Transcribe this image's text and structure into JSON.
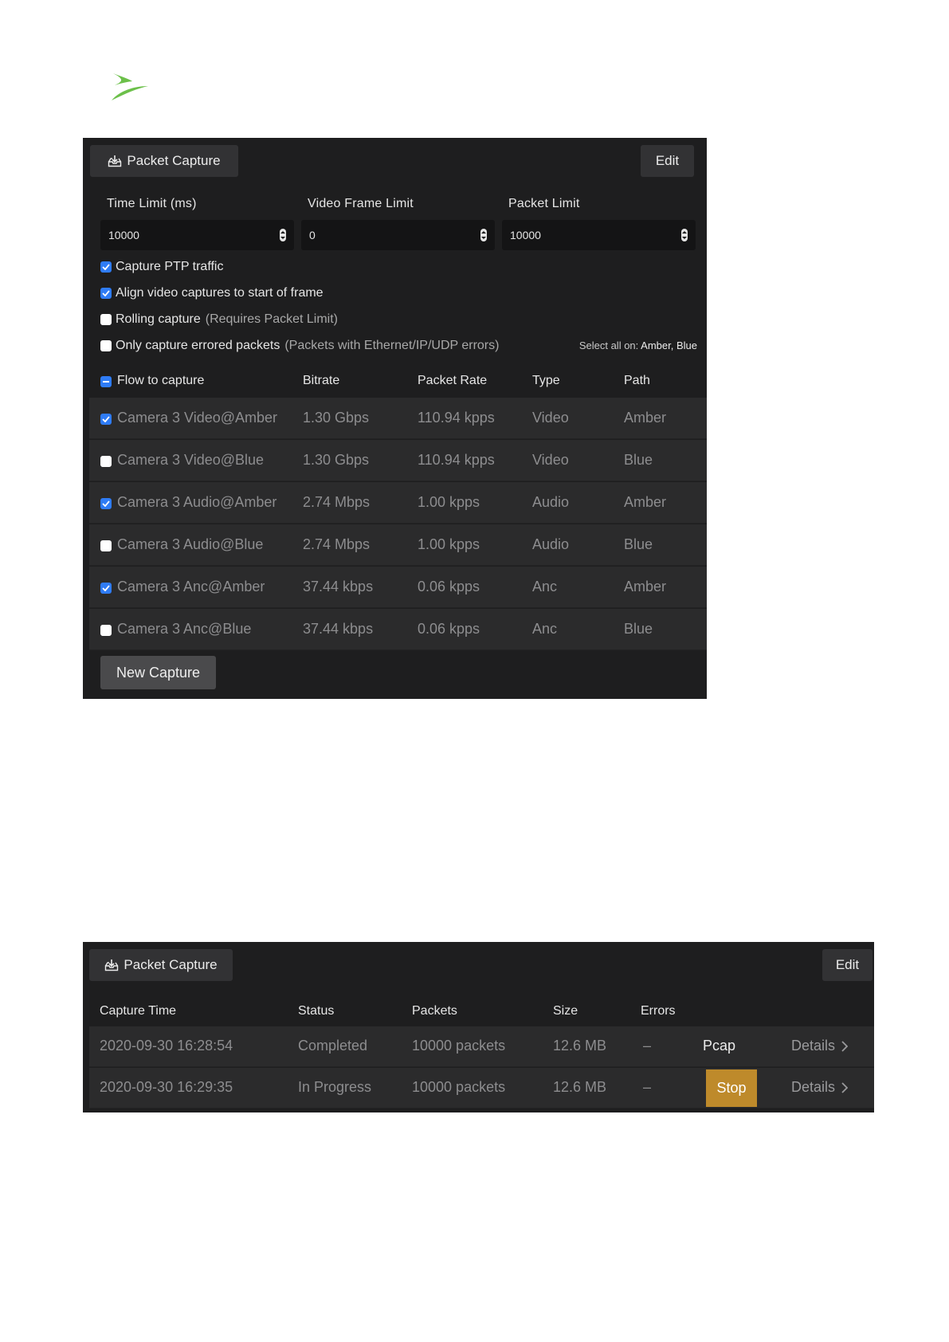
{
  "logo": {
    "icon": "brand-swoosh-logo",
    "color": "#6cc04a"
  },
  "config_panel": {
    "title": "Packet Capture",
    "title_icon": "inbox-download-icon",
    "edit_label": "Edit",
    "fields": [
      {
        "label": "Time Limit (ms)",
        "value": "10000"
      },
      {
        "label": "Video Frame Limit",
        "value": "0"
      },
      {
        "label": "Packet Limit",
        "value": "10000"
      }
    ],
    "options": [
      {
        "label": "Capture PTP traffic",
        "hint": "",
        "checked": true
      },
      {
        "label": "Align video captures to start of frame",
        "hint": "",
        "checked": true
      },
      {
        "label": "Rolling capture",
        "hint": "(Requires Packet Limit)",
        "checked": false
      },
      {
        "label": "Only capture errored packets",
        "hint": "(Packets with Ethernet/IP/UDP errors)",
        "checked": false
      }
    ],
    "select_all": {
      "label": "Select all on:",
      "value": "Amber, Blue"
    },
    "columns": [
      "Flow to capture",
      "Bitrate",
      "Packet Rate",
      "Type",
      "Path"
    ],
    "flows": [
      {
        "name": "Camera 3 Video@Amber",
        "bitrate": "1.30 Gbps",
        "rate": "110.94 kpps",
        "type": "Video",
        "path": "Amber",
        "checked": true
      },
      {
        "name": "Camera 3 Video@Blue",
        "bitrate": "1.30 Gbps",
        "rate": "110.94 kpps",
        "type": "Video",
        "path": "Blue",
        "checked": false
      },
      {
        "name": "Camera 3 Audio@Amber",
        "bitrate": "2.74 Mbps",
        "rate": "1.00 kpps",
        "type": "Audio",
        "path": "Amber",
        "checked": true
      },
      {
        "name": "Camera 3 Audio@Blue",
        "bitrate": "2.74 Mbps",
        "rate": "1.00 kpps",
        "type": "Audio",
        "path": "Blue",
        "checked": false
      },
      {
        "name": "Camera 3 Anc@Amber",
        "bitrate": "37.44 kbps",
        "rate": "0.06 kpps",
        "type": "Anc",
        "path": "Amber",
        "checked": true
      },
      {
        "name": "Camera 3 Anc@Blue",
        "bitrate": "37.44 kbps",
        "rate": "0.06 kpps",
        "type": "Anc",
        "path": "Blue",
        "checked": false
      }
    ],
    "new_capture_label": "New Capture"
  },
  "captures_panel": {
    "title": "Packet Capture",
    "title_icon": "inbox-download-icon",
    "edit_label": "Edit",
    "columns": [
      "Capture Time",
      "Status",
      "Packets",
      "Size",
      "Errors"
    ],
    "rows": [
      {
        "time": "2020-09-30 16:28:54",
        "status": "Completed",
        "packets": "10000 packets",
        "size": "12.6 MB",
        "errors": "–",
        "action": "Pcap",
        "details": "Details"
      },
      {
        "time": "2020-09-30 16:29:35",
        "status": "In Progress",
        "packets": "10000 packets",
        "size": "12.6 MB",
        "errors": "–",
        "action": "Stop",
        "details": "Details"
      }
    ],
    "stop_color": "#be8a2b"
  },
  "colors": {
    "accent": "#2f7cf6",
    "panel_bg": "#1e1e1f",
    "row_bg": "#2b2b2c"
  }
}
